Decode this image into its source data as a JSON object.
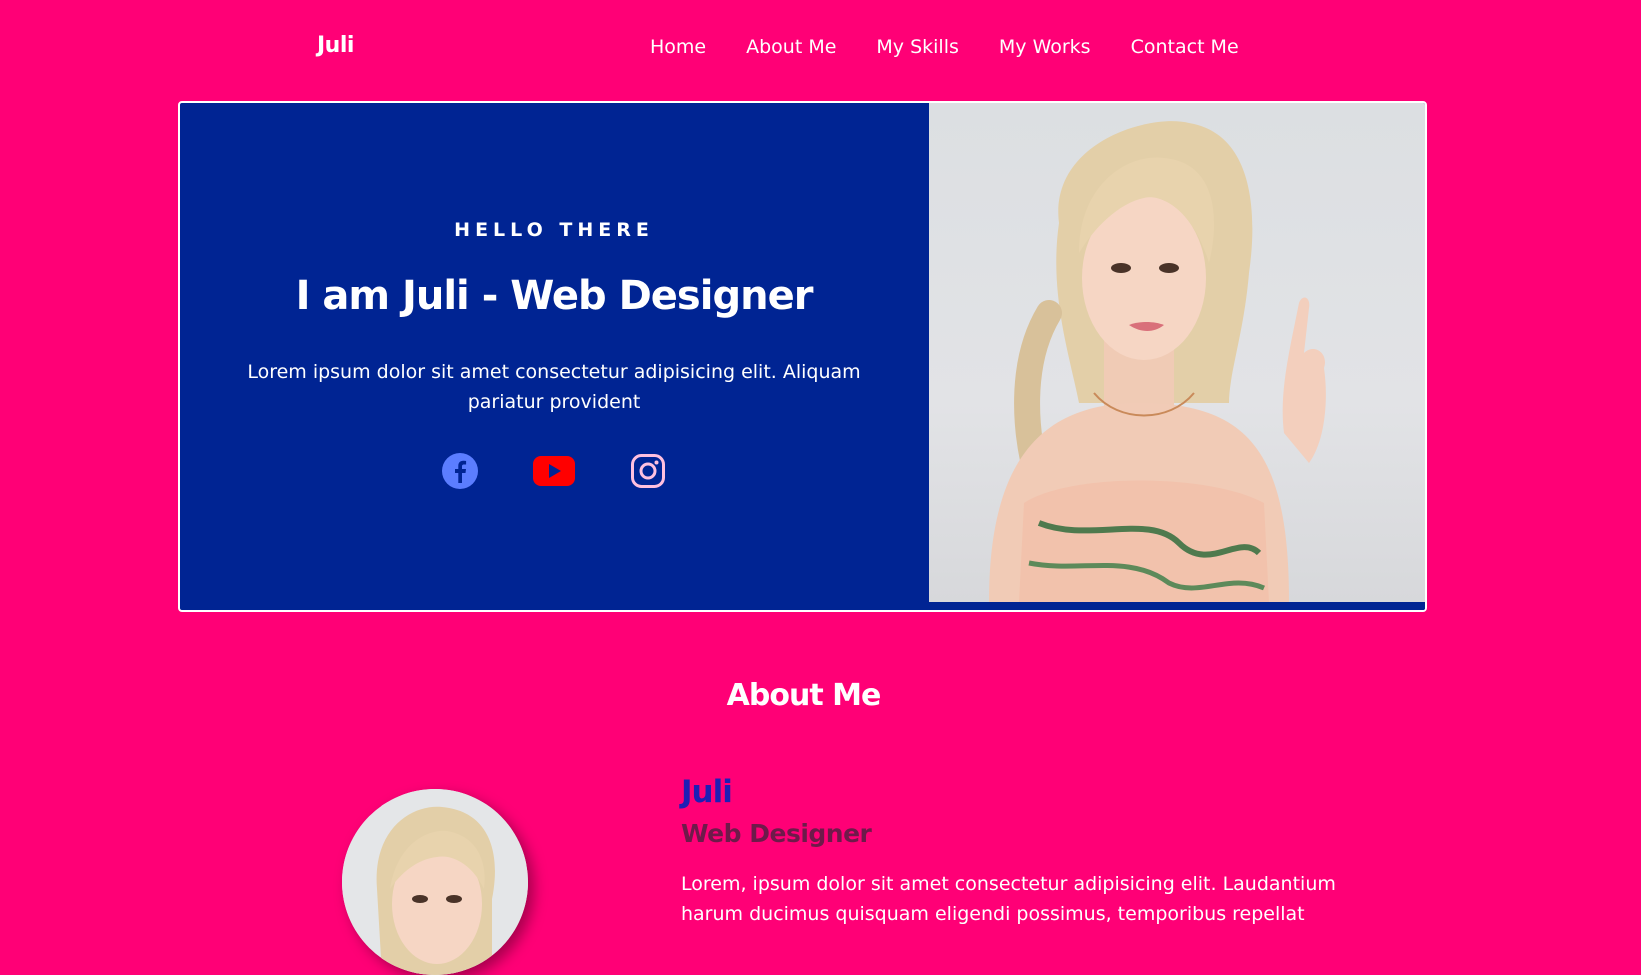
{
  "nav": {
    "logo": "Juli",
    "links": [
      "Home",
      "About Me",
      "My Skills",
      "My Works",
      "Contact Me"
    ]
  },
  "hero": {
    "eyebrow": "HELLO THERE",
    "title": "I am Juli - Web Designer",
    "description": "Lorem ipsum dolor sit amet consectetur adipisicing elit. Aliquam pariatur provident",
    "social": [
      "facebook-icon",
      "youtube-icon",
      "instagram-icon"
    ]
  },
  "about": {
    "heading": "About Me",
    "name": "Juli",
    "role": "Web Designer",
    "text": "Lorem, ipsum dolor sit amet consectetur adipisicing elit. Laudantium harum ducimus quisquam eligendi possimus, temporibus repellat"
  },
  "colors": {
    "background": "#ff0076",
    "hero": "#002493",
    "name": "#1d1fb5",
    "role": "#6e1a4a"
  }
}
